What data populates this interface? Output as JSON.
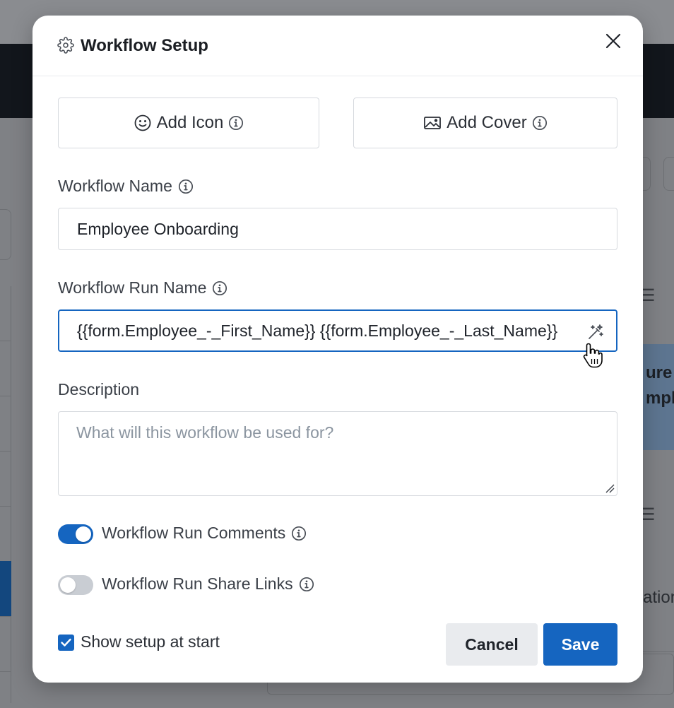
{
  "background": {
    "peek_texts": [
      "ure A",
      "mplo",
      "ation"
    ]
  },
  "modal": {
    "title": "Workflow Setup",
    "add_icon_label": "Add Icon",
    "add_cover_label": "Add Cover",
    "workflow_name": {
      "label": "Workflow Name",
      "value": "Employee Onboarding"
    },
    "workflow_run_name": {
      "label": "Workflow Run Name",
      "value": "{{form.Employee_-_First_Name}} {{form.Employee_-_Last_Name}}"
    },
    "description": {
      "label": "Description",
      "placeholder": "What will this workflow be used for?",
      "value": ""
    },
    "toggles": [
      {
        "label": "Workflow Run Comments",
        "on": true
      },
      {
        "label": "Workflow Run Share Links",
        "on": false
      }
    ],
    "show_setup_at_start": {
      "label": "Show setup at start",
      "checked": true
    },
    "cancel_label": "Cancel",
    "save_label": "Save"
  },
  "colors": {
    "accent": "#1565c0",
    "toggle_off": "#c9cdd3",
    "overlay": "#7f8185"
  },
  "icons": [
    "gear-icon",
    "close-icon",
    "smiley-icon",
    "info-icon",
    "image-icon",
    "magic-wand-icon",
    "hand-pointer-icon",
    "checkmark-icon",
    "resize-handle-icon"
  ]
}
